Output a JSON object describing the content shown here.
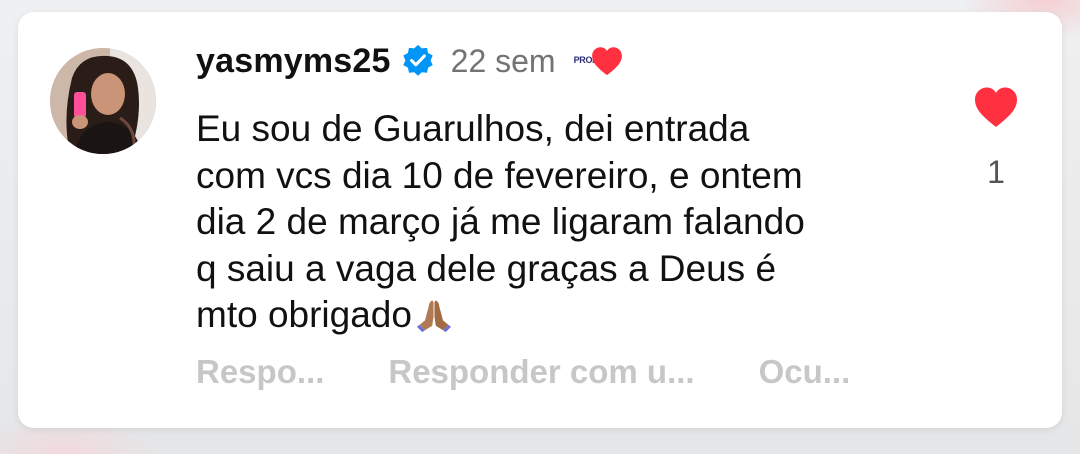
{
  "comment": {
    "username": "yasmyms25",
    "time": "22 sem",
    "creator_badge_text": "PROMA",
    "text": "Eu sou de Guarulhos, dei entrada\ncom vcs dia 10 de fevereiro, e ontem\ndia 2 de março já me ligaram falando\nq saiu a vaga dele graças a Deus é\nmto obrigado",
    "emoji": "pray-icon",
    "like_count": "1"
  },
  "actions": {
    "reply": "Respo...",
    "reply_with": "Responder com u...",
    "hide": "Ocu..."
  },
  "icons": {
    "verified": "verified-badge-icon",
    "liked_by_creator": "heart-icon",
    "like": "heart-icon"
  },
  "colors": {
    "verified_blue": "#0095f6",
    "like_red": "#ff3040",
    "action_gray": "#c7c7c7",
    "time_gray": "#737373"
  }
}
